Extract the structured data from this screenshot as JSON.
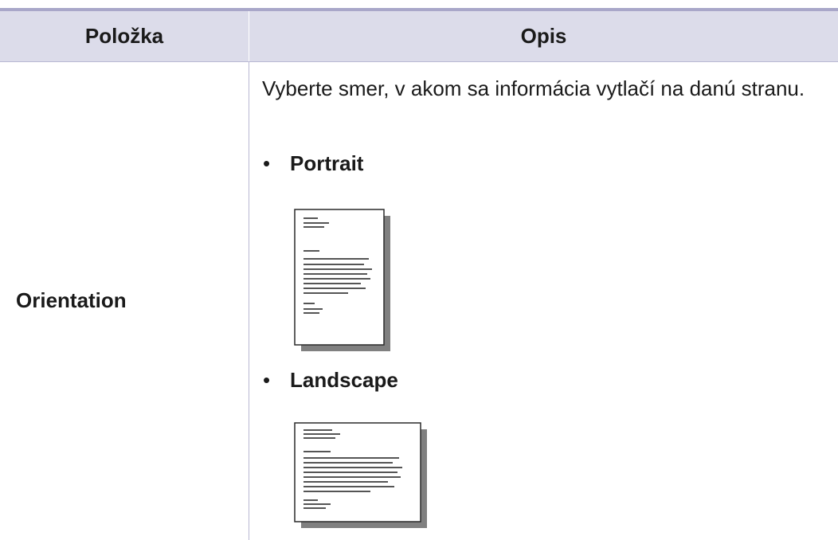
{
  "table": {
    "header": {
      "item": "Položka",
      "description": "Opis"
    },
    "row": {
      "item": "Orientation",
      "description": "Vyberte smer, v akom sa informácia vytlačí na danú stranu.",
      "options": [
        {
          "label": "Portrait",
          "illustration": "portrait-page-icon"
        },
        {
          "label": "Landscape",
          "illustration": "landscape-page-icon"
        }
      ]
    }
  },
  "colors": {
    "header_bg": "#dcdcea",
    "rule": "#a9a7c9",
    "divider": "#b9b8d3",
    "page_shadow": "#808080"
  }
}
